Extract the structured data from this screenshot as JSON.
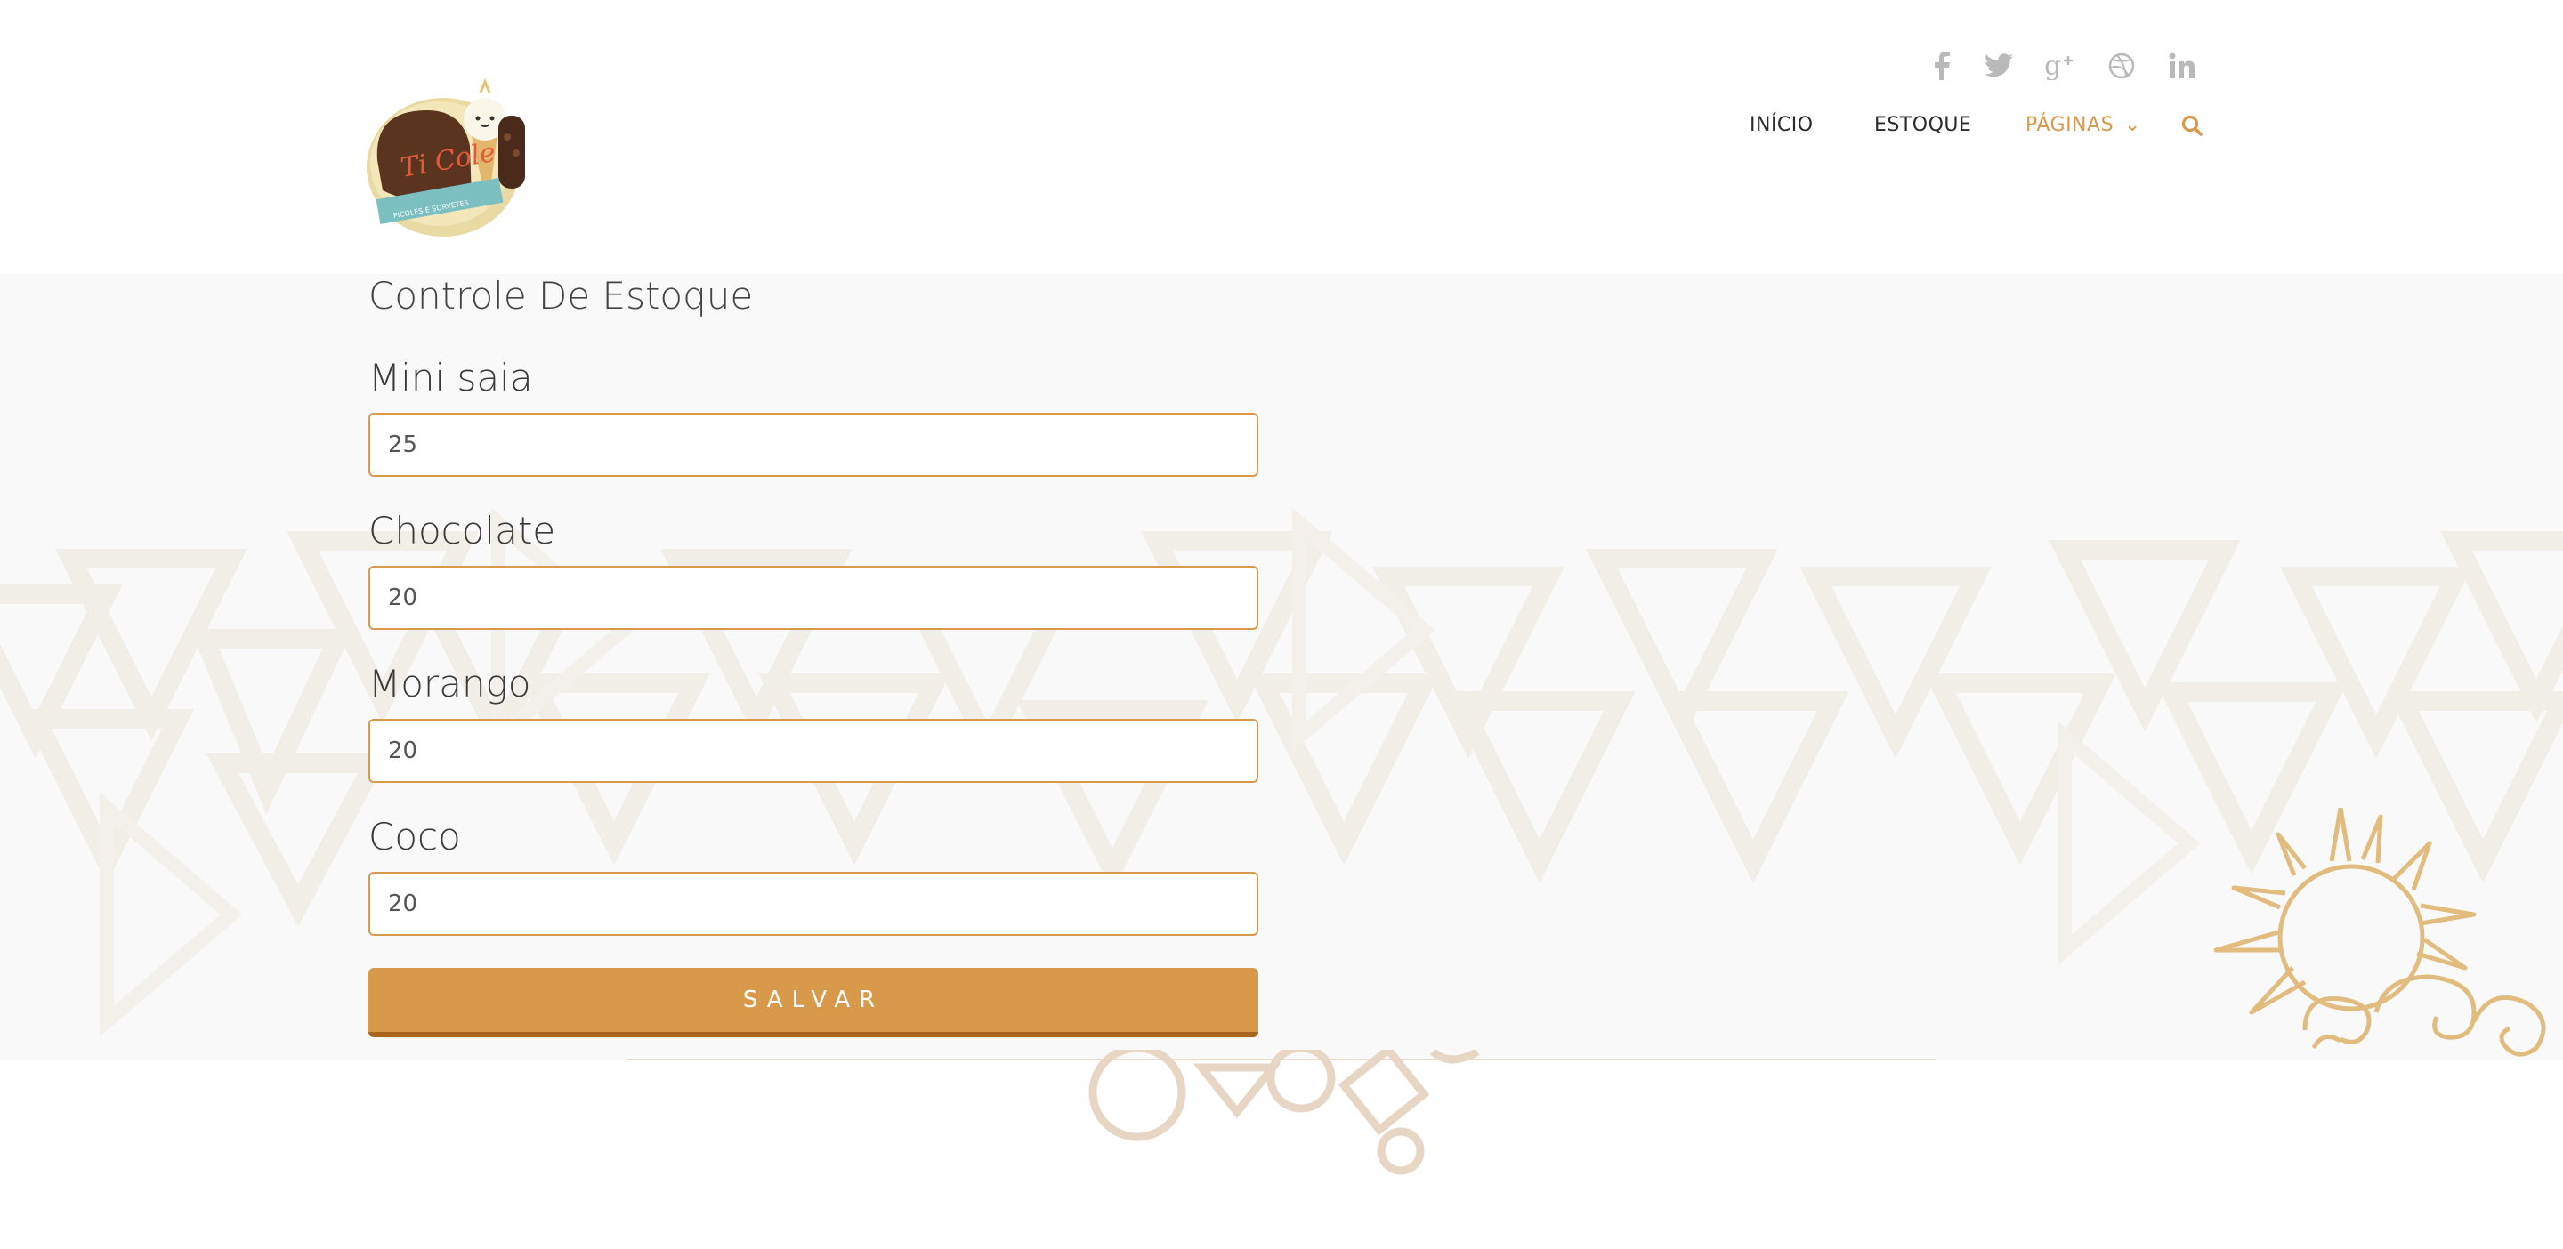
{
  "brand": {
    "logo_text": "Ti Cole",
    "logo_tagline": "PICOLÉS E SORVETES"
  },
  "social": [
    {
      "icon": "facebook-icon",
      "glyph": "f"
    },
    {
      "icon": "twitter-icon",
      "glyph": "🐦"
    },
    {
      "icon": "google-plus-icon",
      "glyph": "g+"
    },
    {
      "icon": "dribbble-icon",
      "glyph": "◎"
    },
    {
      "icon": "linkedin-icon",
      "glyph": "in"
    }
  ],
  "nav": {
    "items": [
      {
        "label": "INÍCIO"
      },
      {
        "label": "ESTOQUE"
      },
      {
        "label": "PÁGINAS"
      }
    ],
    "caret": "⌄",
    "search_icon": "search-icon"
  },
  "main": {
    "title": "Controle De Estoque",
    "fields": [
      {
        "label": "Mini saia",
        "value": "25"
      },
      {
        "label": "Chocolate",
        "value": "20"
      },
      {
        "label": "Morango",
        "value": "20"
      },
      {
        "label": "Coco",
        "value": "20"
      }
    ],
    "save_label": "SALVAR"
  },
  "colors": {
    "accent": "#d8994a",
    "accent_dark": "#a8651f",
    "band_bg": "#f9f9f9",
    "social_icon": "#b9b9b9"
  }
}
